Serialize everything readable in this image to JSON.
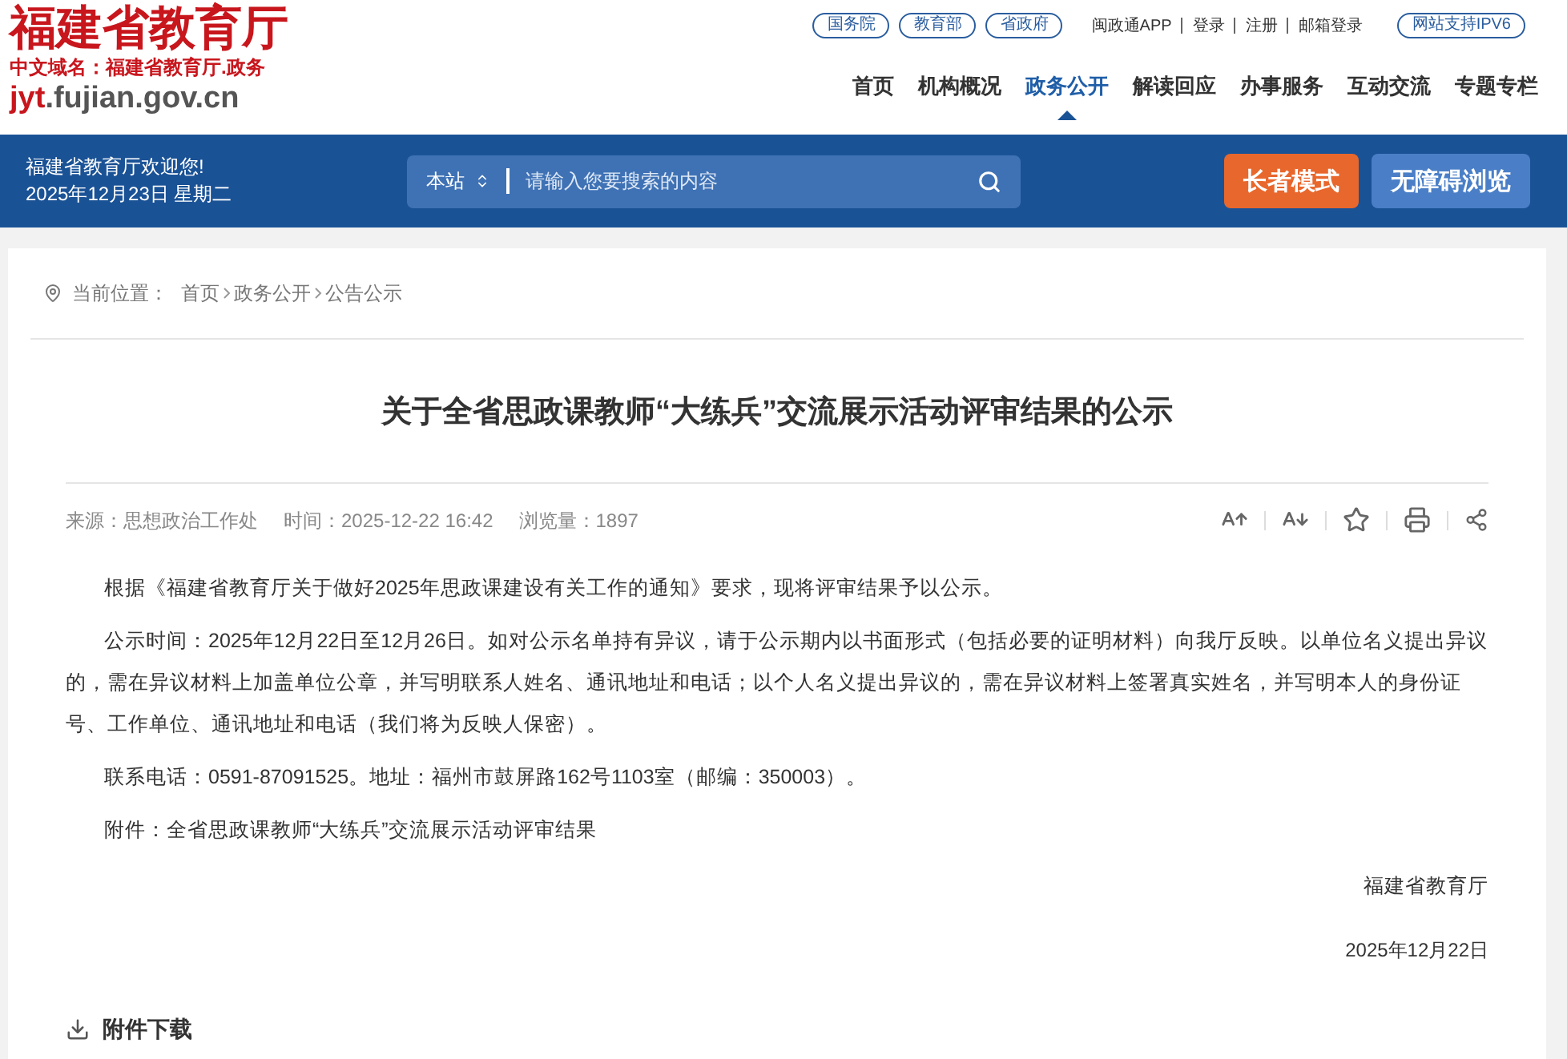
{
  "logo": {
    "title": "福建省教育厅",
    "subtitle": "中文域名：福建省教育厅.政务",
    "domain_highlight": "jyt",
    "domain_rest": ".fujian.gov.cn"
  },
  "top_links": [
    {
      "label": "国务院",
      "kind": "badge"
    },
    {
      "label": "教育部",
      "kind": "badge"
    },
    {
      "label": "省政府",
      "kind": "badge"
    },
    {
      "label": "闽政通APP",
      "kind": "link"
    },
    {
      "label": "登录",
      "kind": "link"
    },
    {
      "label": "注册",
      "kind": "link"
    },
    {
      "label": "邮箱登录",
      "kind": "link"
    },
    {
      "label": "网站支持IPV6",
      "kind": "badge"
    }
  ],
  "nav": [
    {
      "label": "首页",
      "selected": false
    },
    {
      "label": "机构概况",
      "selected": false
    },
    {
      "label": "政务公开",
      "selected": true
    },
    {
      "label": "解读回应",
      "selected": false
    },
    {
      "label": "办事服务",
      "selected": false
    },
    {
      "label": "互动交流",
      "selected": false
    },
    {
      "label": "专题专栏",
      "selected": false
    }
  ],
  "welcome": {
    "greeting": "福建省教育厅欢迎您!",
    "date": "2025年12月23日 星期二"
  },
  "search": {
    "scope": "本站",
    "placeholder": "请输入您要搜索的内容"
  },
  "mode_buttons": [
    {
      "label": "长者模式",
      "kind": "elder"
    },
    {
      "label": "无障碍浏览",
      "kind": "accessible"
    }
  ],
  "breadcrumb": {
    "prefix": "当前位置：",
    "items": [
      "首页",
      "政务公开",
      "公告公示"
    ]
  },
  "article": {
    "title": "关于全省思政课教师“大练兵”交流展示活动评审结果的公示",
    "meta": [
      "来源：思想政治工作处",
      "时间：2025-12-22 16:42",
      "浏览量：1897"
    ],
    "paragraphs": [
      "根据《福建省教育厅关于做好2025年思政课建设有关工作的通知》要求，现将评审结果予以公示。",
      "公示时间：2025年12月22日至12月26日。如对公示名单持有异议，请于公示期内以书面形式（包括必要的证明材料）向我厅反映。以单位名义提出异议的，需在异议材料上加盖单位公章，并写明联系人姓名、通讯地址和电话；以个人名义提出异议的，需在异议材料上签署真实姓名，并写明本人的身份证号、工作单位、通讯地址和电话（我们将为反映人保密）。",
      "联系电话：0591-87091525。地址：福州市鼓屏路162号1103室（邮编：350003）。",
      "附件：全省思政课教师“大练兵”交流展示活动评审结果"
    ],
    "signature": "福建省教育厅",
    "sign_date": "2025年12月22日"
  },
  "attachments": {
    "title": "附件下载"
  }
}
